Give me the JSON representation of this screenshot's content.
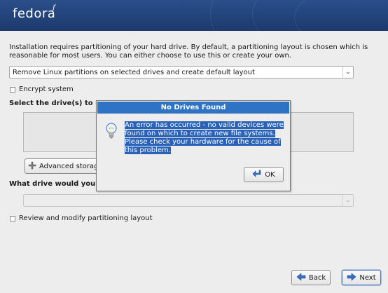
{
  "header": {
    "logo": "fedora",
    "logo_mark": "f"
  },
  "intro_text": "Installation requires partitioning of your hard drive.  By default, a partitioning layout is chosen which is reasonable for most users.  You can either choose to use this or create your own.",
  "layout_select": {
    "value": "Remove Linux partitions on selected drives and create default layout"
  },
  "encrypt_checkbox": {
    "label": "Encrypt system",
    "checked": false
  },
  "select_drives_label": "Select the drive(s) to u",
  "advanced_button": {
    "label": "Advanced storag"
  },
  "boot_drive_label": "What drive would you",
  "boot_drive_select": {
    "value": ""
  },
  "review_checkbox": {
    "label": "Review and modify partitioning layout",
    "checked": false
  },
  "nav": {
    "back_label": "Back",
    "next_label": "Next"
  },
  "dialog": {
    "title": "No Drives Found",
    "message": "An error has occurred - no valid devices were found on which to create new file systems. Please check your hardware for the cause of this problem.",
    "ok_label": "OK"
  },
  "colors": {
    "banner": "#24457d",
    "dialog_title": "#2f73c4",
    "selection": "#2a62b8"
  }
}
